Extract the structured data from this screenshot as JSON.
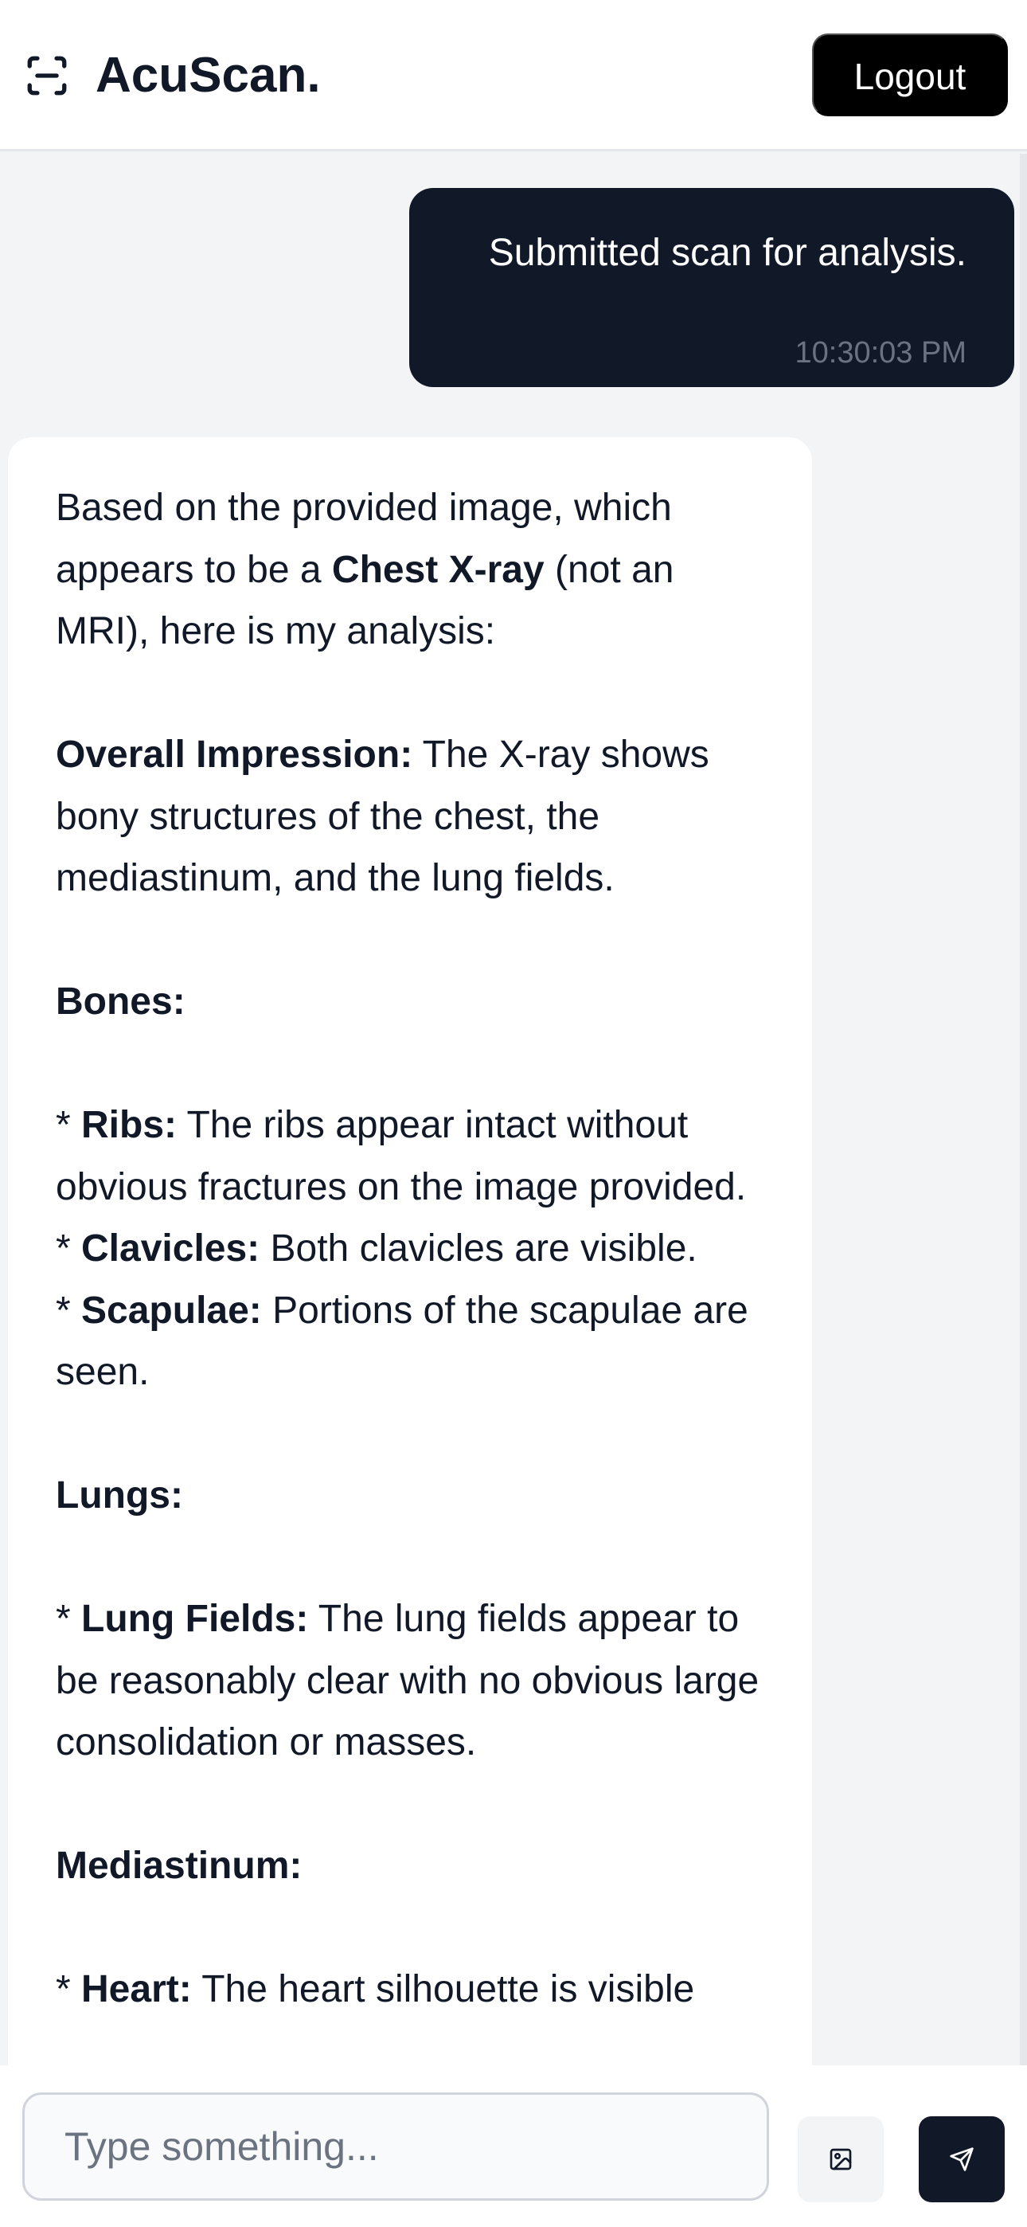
{
  "header": {
    "brand_icon": "scan-icon",
    "brand_name": "AcuScan.",
    "logout_label": "Logout"
  },
  "messages": [
    {
      "role": "user",
      "text": "Submitted scan for analysis.",
      "time": "10:30:03 PM"
    },
    {
      "role": "assistant",
      "paragraphs": [
        {
          "pre": "Based on the provided image, which appears to be a ",
          "bold": "Chest X-ray",
          "post": " (not an MRI), here is my analysis:"
        },
        {
          "pre": "",
          "bold": "Overall Impression:",
          "post": " The X-ray shows bony structures of the chest, the mediastinum, and the lung fields."
        },
        {
          "pre": "",
          "bold": "Bones:",
          "post": ""
        },
        {
          "pre": "* ",
          "bold": "Ribs:",
          "post": " The ribs appear intact without obvious fractures on the image provided."
        },
        {
          "pre": "* ",
          "bold": "Clavicles:",
          "post": " Both clavicles are visible."
        },
        {
          "pre": "* ",
          "bold": "Scapulae:",
          "post": " Portions of the scapulae are seen."
        },
        {
          "pre": "",
          "bold": "Lungs:",
          "post": ""
        },
        {
          "pre": "* ",
          "bold": "Lung Fields:",
          "post": " The lung fields appear to be reasonably clear with no obvious large consolidation or masses."
        },
        {
          "pre": "",
          "bold": "Mediastinum:",
          "post": ""
        },
        {
          "pre": "* ",
          "bold": "Heart:",
          "post": " The heart silhouette is visible"
        }
      ]
    }
  ],
  "composer": {
    "placeholder": "Type something...",
    "image_button_icon": "image-icon",
    "send_button_icon": "send-icon"
  },
  "colors": {
    "dark": "#111827",
    "background": "#f3f4f6",
    "muted": "#6b7280"
  }
}
